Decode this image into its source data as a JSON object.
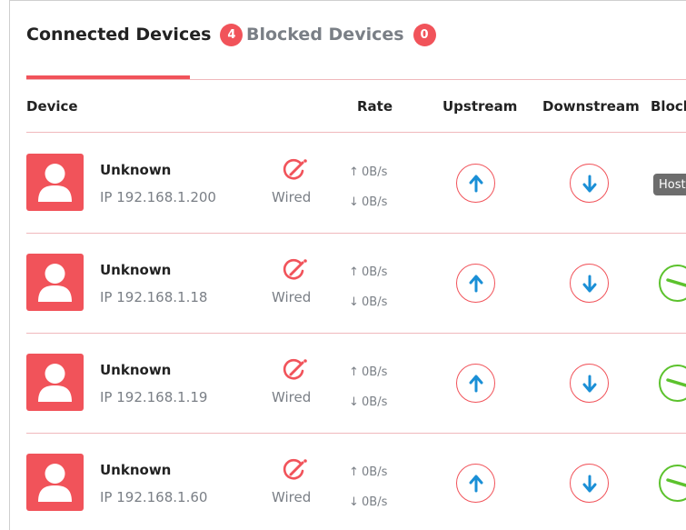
{
  "tabs": [
    {
      "label": "Connected Devices",
      "count": "4",
      "active": true
    },
    {
      "label": "Blocked Devices",
      "count": "0",
      "active": false
    }
  ],
  "table": {
    "headers": {
      "device": "Device",
      "rate": "Rate",
      "upstream": "Upstream",
      "downstream": "Downstream",
      "block": "Block"
    },
    "rows": [
      {
        "name": "Unknown",
        "ip": "IP 192.168.1.200",
        "type": "Wired",
        "up_rate": "0B/s",
        "down_rate": "0B/s",
        "block": "Host"
      },
      {
        "name": "Unknown",
        "ip": "IP 192.168.1.18",
        "type": "Wired",
        "up_rate": "0B/s",
        "down_rate": "0B/s",
        "block": ""
      },
      {
        "name": "Unknown",
        "ip": "IP 192.168.1.19",
        "type": "Wired",
        "up_rate": "0B/s",
        "down_rate": "0B/s",
        "block": ""
      },
      {
        "name": "Unknown",
        "ip": "IP 192.168.1.60",
        "type": "Wired",
        "up_rate": "0B/s",
        "down_rate": "0B/s",
        "block": ""
      }
    ]
  },
  "icons": {
    "avatar": "user-avatar-icon",
    "edit": "edit-pencil-icon",
    "upstream": "arrow-up-icon",
    "downstream": "arrow-down-icon",
    "block": "block-toggle-icon",
    "rate_up": "↑",
    "rate_down": "↓"
  },
  "colors": {
    "accent": "#f1535a",
    "divider": "#f0b8bc",
    "arrow": "#1a8fd6",
    "block": "#5cc22d",
    "host_tag": "#6d6d6d",
    "muted_text": "#7a7f86"
  }
}
